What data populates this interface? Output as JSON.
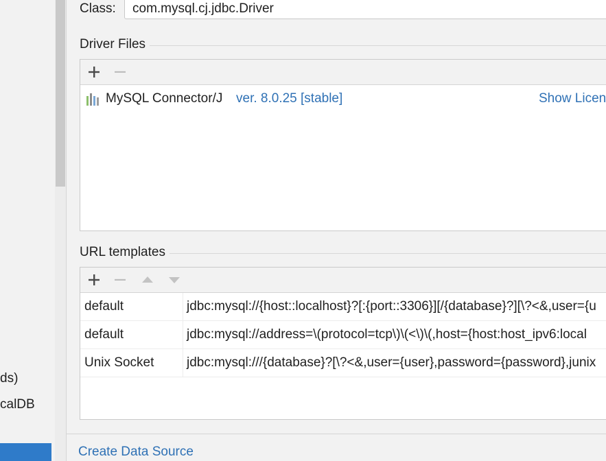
{
  "sidebar": {
    "items": [
      {
        "label": "ds)"
      },
      {
        "label": "calDB"
      }
    ]
  },
  "driver": {
    "class_label": "Class:",
    "class_value": "com.mysql.cj.jdbc.Driver"
  },
  "driver_files": {
    "title": "Driver Files",
    "files": [
      {
        "name": "MySQL Connector/J",
        "version": "ver. 8.0.25 [stable]",
        "license_link": "Show Licens"
      }
    ]
  },
  "url_templates": {
    "title": "URL templates",
    "rows": [
      {
        "name": "default",
        "template": "jdbc:mysql://{host::localhost}?[:{port::3306}][/{database}?][\\?<&,user={u"
      },
      {
        "name": "default",
        "template": "jdbc:mysql://address=\\(protocol=tcp\\)\\(<\\)\\(,host={host:host_ipv6:local"
      },
      {
        "name": "Unix Socket",
        "template": "jdbc:mysql:///{database}?[\\?<&,user={user},password={password},junix"
      }
    ]
  },
  "footer": {
    "create_link": "Create Data Source"
  },
  "colors": {
    "link": "#2f71b5",
    "selection": "#2f7bc9",
    "panel_bg": "#f2f2f2"
  }
}
